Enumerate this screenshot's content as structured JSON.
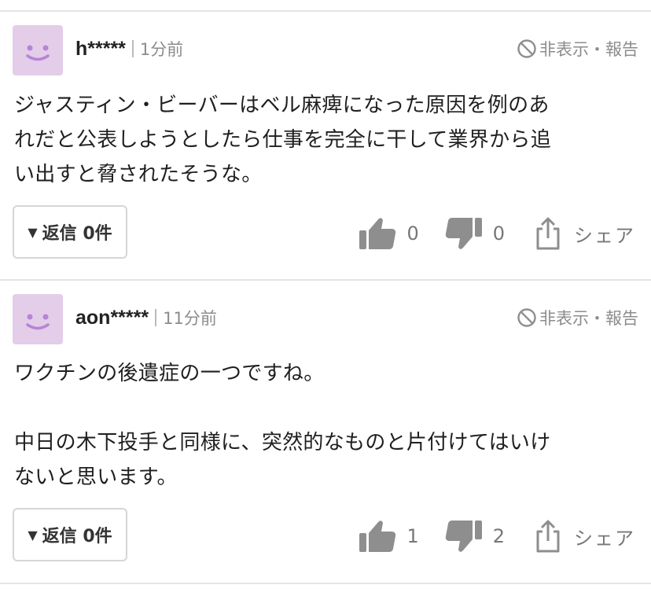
{
  "comments": [
    {
      "username": "h*****",
      "time": "1分前",
      "hide_report": "非表示・報告",
      "lines": [
        "ジャスティン・ビーバーはベル麻痺になった原因を例のあ",
        "れだと公表しようとしたら仕事を完全に干して業界から追",
        "い出すと脅されたそうな。"
      ],
      "reply_label": "返信 0件",
      "likes": "0",
      "dislikes": "0",
      "share_label": "シェア"
    },
    {
      "username": "aon*****",
      "time": "11分前",
      "hide_report": "非表示・報告",
      "lines": [
        "ワクチンの後遺症の一つですね。",
        "",
        "中日の木下投手と同様に、突然的なものと片付けてはいけ",
        "ないと思います。"
      ],
      "reply_label": "返信 0件",
      "likes": "1",
      "dislikes": "2",
      "share_label": "シェア"
    }
  ],
  "colors": {
    "avatar_bg": "#e3cde9",
    "avatar_face": "#b784d6",
    "icon_gray": "#8e8e8e",
    "divider": "#e4e4e4"
  },
  "icons": [
    "smiley-avatar",
    "no-entry-icon",
    "thumbs-up-icon",
    "thumbs-down-icon",
    "share-icon",
    "triangle-down-icon"
  ]
}
